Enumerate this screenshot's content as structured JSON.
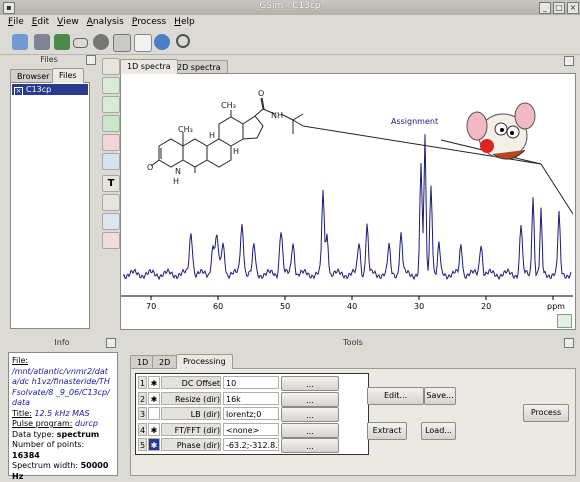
{
  "window": {
    "title": "GSim - C13cp"
  },
  "menu": [
    {
      "label": "File",
      "underline": "F",
      "rest": "ile"
    },
    {
      "label": "Edit",
      "underline": "E",
      "rest": "dit"
    },
    {
      "label": "View",
      "underline": "V",
      "rest": "iew"
    },
    {
      "label": "Analysis",
      "underline": "A",
      "rest": "nalysis"
    },
    {
      "label": "Process",
      "underline": "P",
      "rest": "rocess"
    },
    {
      "label": "Help",
      "underline": "H",
      "rest": "elp"
    }
  ],
  "toolbar": [
    "open-folder-icon",
    "save-icon",
    "save-as-icon",
    "glasses-icon",
    "close-circle-icon",
    "print-icon",
    "copy-icon",
    "sync-icon",
    "search-icon"
  ],
  "files_pane": {
    "title": "Files",
    "tabs": [
      "Browser",
      "Files"
    ],
    "active_tab": "Files",
    "items": [
      "C13cp"
    ]
  },
  "spectrum_tabs": [
    "1D spectra",
    "2D spectra"
  ],
  "spectrum": {
    "annotation": "Assignment",
    "x_ticks": [
      "70",
      "60",
      "50",
      "40",
      "30",
      "20",
      "ppm"
    ],
    "molecule_labels": {
      "H1": "H",
      "H2": "H",
      "H3": "H",
      "CH3a": "CH₃",
      "CH3b": "CH₃",
      "O1": "O",
      "O2": "O",
      "NH1": "NH",
      "NH2": "H",
      "N": "N"
    }
  },
  "info_pane": {
    "title": "Info",
    "file_label": "File:",
    "file_path": "/mnt/atlantic/vnmr2/data/dc h1vz/finasteride/THFsolvate/8 _9_06/C13cp/data",
    "title_label": "Title:",
    "title_value": "12.5 kHz MAS",
    "pulse_label": "Pulse program:",
    "pulse_value": "durcp",
    "datatype_label": "Data type:",
    "datatype_value": "spectrum",
    "points_label": "Number of points:",
    "points_value": "16384",
    "width_label": "Spectrum width:",
    "width_value": "50000 Hz"
  },
  "tools_pane": {
    "title": "Tools",
    "tabs": [
      "1D",
      "2D",
      "Processing"
    ],
    "active_tab": "Processing",
    "rows": [
      {
        "n": "1",
        "name": "DC Offset",
        "value": "10",
        "more": "...",
        "checked": true
      },
      {
        "n": "2",
        "name": "Resize (dir)",
        "value": "16k",
        "more": "...",
        "checked": true
      },
      {
        "n": "3",
        "name": "LB (dir)",
        "value": "lorentz;0",
        "more": "...",
        "checked": false
      },
      {
        "n": "4",
        "name": "FT/FFT (dir)",
        "value": "<none>",
        "more": "...",
        "checked": true
      },
      {
        "n": "5",
        "name": "Phase (dir)",
        "value": "-63.2;-312.8...",
        "more": "...",
        "checked": true
      }
    ],
    "buttons": {
      "edit": "Edit...",
      "save": "Save...",
      "extract": "Extract",
      "load": "Load...",
      "process": "Process"
    }
  },
  "colors": {
    "spectrum": "#1a1a7a",
    "link": "#1a1aa6",
    "selection": "#2a3b8f"
  }
}
